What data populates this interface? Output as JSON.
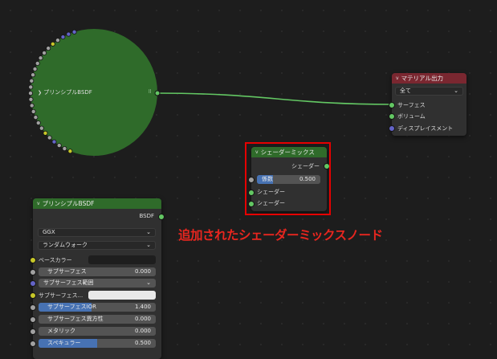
{
  "collapsed_node": {
    "title": "プリンシプルBSDF",
    "color": "#2f6b2a"
  },
  "output_node": {
    "title": "マテリアル出力",
    "dropdown": "全て",
    "inputs": [
      "サーフェス",
      "ボリューム",
      "ディスプレイスメント"
    ],
    "header_color": "#7a2730"
  },
  "mix_node": {
    "title": "シェーダーミックス",
    "output": "シェーダー",
    "fac_label": "係数",
    "fac_value": "0.500",
    "fac_fraction": 0.5,
    "inputs": [
      "シェーダー",
      "シェーダー"
    ],
    "header_color": "#2f6b2a"
  },
  "bsdf_node": {
    "title": "プリンシプルBSDF",
    "output": "BSDF",
    "distribution": "GGX",
    "subsurface_method": "ランダムウォーク",
    "base_color_label": "ベースカラー",
    "subsurface_label": "サブサーフェス",
    "subsurface_value": "0.000",
    "subsurface_radius_label": "サブサーフェス範囲",
    "subsurface_color_label": "サブサーフェス...",
    "subsurface_ior_label": "サブサーフェスIOR",
    "subsurface_ior_value": "1.400",
    "subsurface_ior_fraction": 0.45,
    "subsurface_aniso_label": "サブサーフェス異方性",
    "subsurface_aniso_value": "0.000",
    "metallic_label": "メタリック",
    "metallic_value": "0.000",
    "specular_label": "スペキュラー",
    "specular_value": "0.500",
    "specular_fraction": 0.5,
    "header_color": "#2f6b2a"
  },
  "annotation": "追加されたシェーダーミックスノード",
  "colors": {
    "wire": "#63c763",
    "highlight": "#e60000",
    "annotation": "#e8261f"
  }
}
